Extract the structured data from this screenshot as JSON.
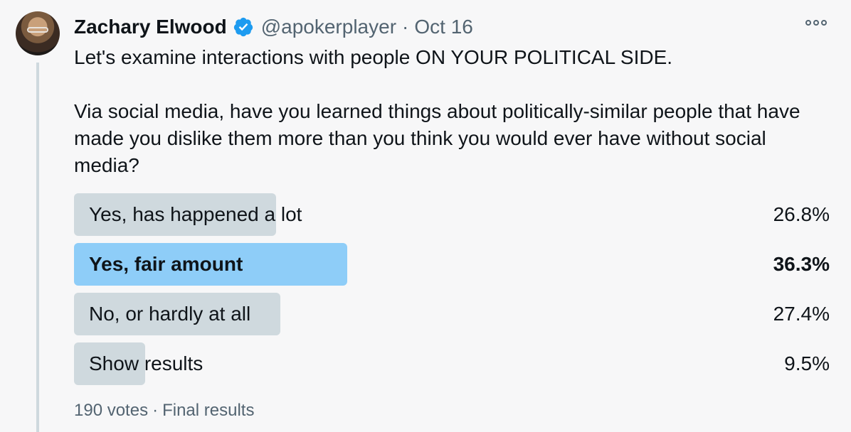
{
  "author": {
    "name": "Zachary Elwood",
    "handle": "@apokerplayer",
    "separator": "·",
    "date": "Oct 16",
    "verified_color": "#1d9bf0"
  },
  "tweet": {
    "paragraph1": "Let's examine interactions with people ON YOUR POLITICAL SIDE.",
    "paragraph2": "Via social media, have you learned things about politically-similar people that have made you dislike them more than you think you would ever have without social media?"
  },
  "poll": {
    "options": [
      {
        "label": "Yes, has happened a lot",
        "percent_text": "26.8%",
        "percent": 26.8,
        "winner": false
      },
      {
        "label": "Yes, fair amount",
        "percent_text": "36.3%",
        "percent": 36.3,
        "winner": true
      },
      {
        "label": "No, or hardly at all",
        "percent_text": "27.4%",
        "percent": 27.4,
        "winner": false
      },
      {
        "label": "Show results",
        "percent_text": "9.5%",
        "percent": 9.5,
        "winner": false
      }
    ],
    "votes": "190 votes",
    "separator": "·",
    "status": "Final results",
    "bar_color": "#cfd9de",
    "winner_bar_color": "#8ecdf8"
  },
  "icons": {
    "more": "more-horizontal-icon",
    "verified": "verified-badge-icon"
  }
}
